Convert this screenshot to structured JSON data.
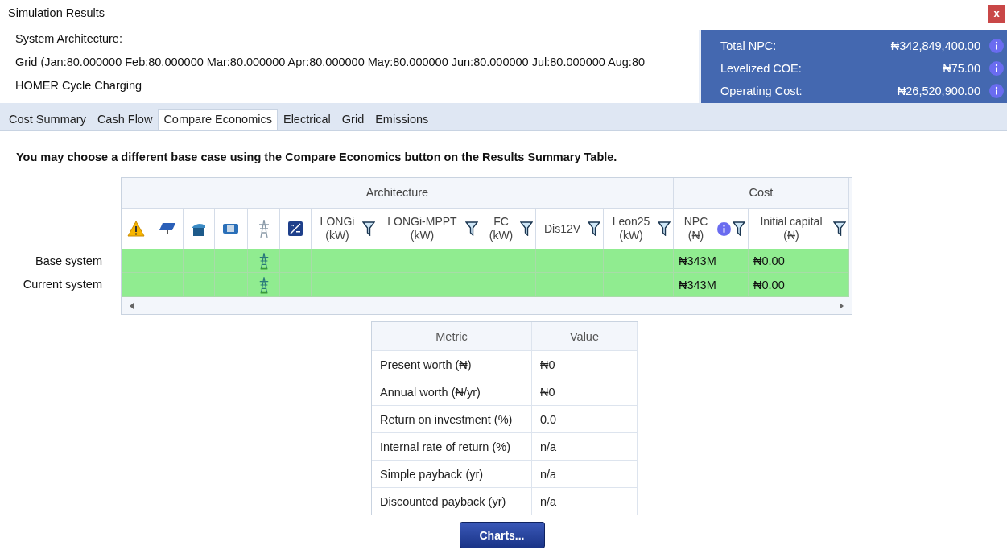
{
  "window": {
    "title": "Simulation Results",
    "close": "x"
  },
  "architecture": {
    "heading": "System Architecture:",
    "grid_line": "Grid (Jan:80.000000 Feb:80.000000 Mar:80.000000 Apr:80.000000 May:80.000000 Jun:80.000000 Jul:80.000000 Aug:80",
    "dispatch": "HOMER Cycle Charging"
  },
  "summary": [
    {
      "label": "Total NPC:",
      "value": "₦342,849,400.00"
    },
    {
      "label": "Levelized COE:",
      "value": "₦75.00"
    },
    {
      "label": "Operating Cost:",
      "value": "₦26,520,900.00"
    }
  ],
  "tabs": [
    {
      "label": "Cost Summary",
      "selected": false
    },
    {
      "label": "Cash Flow",
      "selected": false
    },
    {
      "label": "Compare Economics",
      "selected": true
    },
    {
      "label": "Electrical",
      "selected": false
    },
    {
      "label": "Grid",
      "selected": false
    },
    {
      "label": "Emissions",
      "selected": false
    }
  ],
  "note": "You may choose a different base case using the Compare Economics button on the Results Summary Table.",
  "results": {
    "groups": [
      {
        "label": "Architecture",
        "columns": [
          {
            "kind": "icon"
          },
          {
            "kind": "icon"
          },
          {
            "kind": "icon"
          },
          {
            "kind": "icon"
          },
          {
            "kind": "icon"
          },
          {
            "kind": "icon"
          },
          {
            "kind": "text",
            "label": "LONGi",
            "unit": "(kW)"
          },
          {
            "kind": "text",
            "label": "LONGi-MPPT",
            "unit": "(kW)"
          },
          {
            "kind": "text",
            "label": "FC",
            "unit": "(kW)"
          },
          {
            "kind": "text",
            "label": "Dis12V"
          },
          {
            "kind": "text",
            "label": "Leon25",
            "unit": "(kW)"
          }
        ]
      },
      {
        "label": "Cost",
        "columns": [
          {
            "kind": "text",
            "label": "NPC",
            "unit": "(₦)",
            "info": true
          },
          {
            "kind": "text",
            "label": "Initial capital",
            "unit": "(₦)"
          }
        ]
      }
    ],
    "rows": [
      {
        "label": "Base system",
        "grid": true,
        "npc": "₦343M",
        "initial_capital": "₦0.00"
      },
      {
        "label": "Current system",
        "grid": true,
        "npc": "₦343M",
        "initial_capital": "₦0.00"
      }
    ]
  },
  "metrics": {
    "columns": [
      "Metric",
      "Value"
    ],
    "rows": [
      {
        "metric": "Present worth (₦)",
        "value": "₦0"
      },
      {
        "metric": "Annual worth (₦/yr)",
        "value": "₦0"
      },
      {
        "metric": "Return on investment (%)",
        "value": "0.0"
      },
      {
        "metric": "Internal rate of return (%)",
        "value": "n/a"
      },
      {
        "metric": "Simple payback (yr)",
        "value": "n/a"
      },
      {
        "metric": "Discounted payback (yr)",
        "value": "n/a"
      }
    ]
  },
  "charts_button": "Charts..."
}
